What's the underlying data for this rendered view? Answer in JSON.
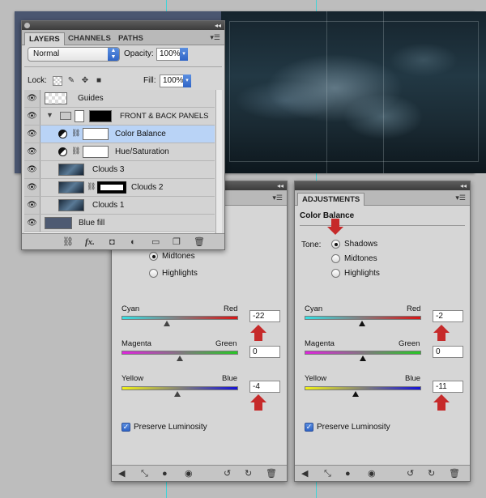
{
  "layers_panel": {
    "tabs": [
      "LAYERS",
      "CHANNELS",
      "PATHS"
    ],
    "blend_mode": "Normal",
    "opacity_label": "Opacity:",
    "opacity_value": "100%",
    "lock_label": "Lock:",
    "fill_label": "Fill:",
    "fill_value": "100%",
    "layers": [
      {
        "name": "Guides",
        "type": "normal",
        "visible": true,
        "selected": false
      },
      {
        "name": "FRONT & BACK PANELS",
        "type": "group",
        "visible": true,
        "selected": false
      },
      {
        "name": "Color Balance",
        "type": "adjustment",
        "visible": true,
        "selected": true
      },
      {
        "name": "Hue/Saturation",
        "type": "adjustment",
        "visible": true,
        "selected": false
      },
      {
        "name": "Clouds 3",
        "type": "normal",
        "visible": true,
        "selected": false
      },
      {
        "name": "Clouds 2",
        "type": "masked",
        "visible": true,
        "selected": false
      },
      {
        "name": "Clouds 1",
        "type": "normal",
        "visible": true,
        "selected": false
      },
      {
        "name": "Blue fill",
        "type": "normal",
        "visible": true,
        "selected": false
      }
    ],
    "footer_icons": [
      "link-icon",
      "fx-icon",
      "mask-icon",
      "adjustment-layer-icon",
      "folder-icon",
      "new-layer-icon",
      "trash-icon"
    ],
    "fx_label": "fx."
  },
  "adj_left": {
    "tone": "Midtones",
    "tone_options": [
      "Midtones",
      "Highlights"
    ],
    "sliders": [
      {
        "left": "Cyan",
        "right": "Red",
        "value": "-22",
        "position": 0.39
      },
      {
        "left": "Magenta",
        "right": "Green",
        "value": "0",
        "position": 0.5
      },
      {
        "left": "Yellow",
        "right": "Blue",
        "value": "-4",
        "position": 0.48
      }
    ],
    "preserve_luminosity": "Preserve Luminosity"
  },
  "adj_right": {
    "tab": "ADJUSTMENTS",
    "title": "Color Balance",
    "tone_label": "Tone:",
    "tone": "Shadows",
    "tone_options": [
      "Shadows",
      "Midtones",
      "Highlights"
    ],
    "sliders": [
      {
        "left": "Cyan",
        "right": "Red",
        "value": "-2",
        "position": 0.49
      },
      {
        "left": "Magenta",
        "right": "Green",
        "value": "0",
        "position": 0.5
      },
      {
        "left": "Yellow",
        "right": "Blue",
        "value": "-11",
        "position": 0.44
      }
    ],
    "preserve_luminosity": "Preserve Luminosity"
  },
  "colors": {
    "selection": "#b9d3f6",
    "panel_bg": "#d6d6d6",
    "arrow_red": "#c62a2a",
    "guide": "#3fd3d8",
    "canvas_fill": "#4a5670"
  }
}
